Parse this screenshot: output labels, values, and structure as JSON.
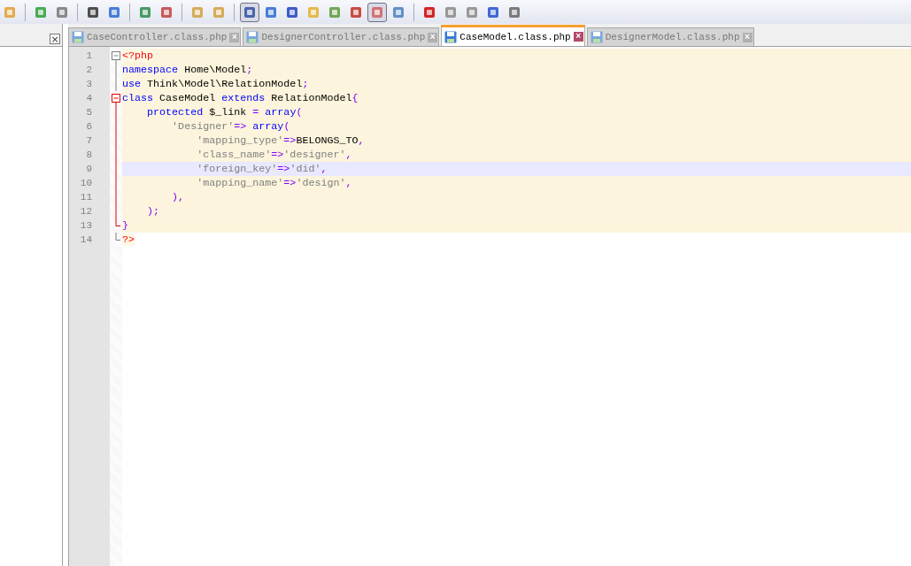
{
  "toolbar": [
    [
      {
        "pressed": false
      }
    ],
    [
      {
        "pressed": false
      },
      {
        "pressed": false
      }
    ],
    [
      {
        "pressed": false
      },
      {
        "pressed": false
      }
    ],
    [
      {
        "pressed": false
      },
      {
        "pressed": false
      }
    ],
    [
      {
        "pressed": false
      },
      {
        "pressed": false
      }
    ],
    [
      {
        "pressed": true
      },
      {
        "pressed": false
      },
      {
        "pressed": false
      },
      {
        "pressed": false
      },
      {
        "pressed": false
      },
      {
        "pressed": false
      },
      {
        "pressed": true
      },
      {
        "pressed": false
      }
    ],
    [
      {
        "pressed": false
      },
      {
        "pressed": false
      },
      {
        "pressed": false
      },
      {
        "pressed": false
      },
      {
        "pressed": false
      }
    ]
  ],
  "side_panel": {
    "close": "×"
  },
  "tabs": [
    {
      "label": "CaseController.class.php",
      "selected": false,
      "close": "×"
    },
    {
      "label": "DesignerController.class.php",
      "selected": false,
      "close": "×"
    },
    {
      "label": "CaseModel.class.php",
      "selected": true,
      "close": "×"
    },
    {
      "label": "DesignerModel.class.php",
      "selected": false,
      "close": "×"
    }
  ],
  "editor": {
    "lines": [
      {
        "number": "1",
        "current": false,
        "embedded": true,
        "kind": "start",
        "active": false,
        "tokens": [
          {
            "kind": "php",
            "text": "<?php"
          }
        ]
      },
      {
        "number": "2",
        "current": false,
        "embedded": true,
        "kind": "body",
        "active": false,
        "tokens": [
          {
            "kind": "kw",
            "text": "namespace"
          },
          {
            "kind": "plain",
            "text": " Home\\Model"
          },
          {
            "kind": "op",
            "text": ";"
          }
        ]
      },
      {
        "number": "3",
        "current": false,
        "embedded": true,
        "kind": "body",
        "active": false,
        "tokens": [
          {
            "kind": "kw",
            "text": "use"
          },
          {
            "kind": "plain",
            "text": " Think\\Model\\RelationModel"
          },
          {
            "kind": "op",
            "text": ";"
          }
        ]
      },
      {
        "number": "4",
        "current": false,
        "embedded": true,
        "kind": "start",
        "active": true,
        "tokens": [
          {
            "kind": "kw",
            "text": "class"
          },
          {
            "kind": "plain",
            "text": " CaseModel "
          },
          {
            "kind": "kw",
            "text": "extends"
          },
          {
            "kind": "plain",
            "text": " RelationModel"
          },
          {
            "kind": "op",
            "text": "{"
          }
        ]
      },
      {
        "number": "5",
        "current": false,
        "embedded": true,
        "kind": "body",
        "active": true,
        "tokens": [
          {
            "kind": "kw",
            "text": "    protected"
          },
          {
            "kind": "plain",
            "text": " $_link "
          },
          {
            "kind": "op",
            "text": "="
          },
          {
            "kind": "kw",
            "text": " array"
          },
          {
            "kind": "op",
            "text": "("
          }
        ]
      },
      {
        "number": "6",
        "current": false,
        "embedded": true,
        "kind": "body",
        "active": true,
        "tokens": [
          {
            "kind": "str",
            "text": "        'Designer'"
          },
          {
            "kind": "op",
            "text": "=>"
          },
          {
            "kind": "kw",
            "text": " array"
          },
          {
            "kind": "op",
            "text": "("
          }
        ]
      },
      {
        "number": "7",
        "current": false,
        "embedded": true,
        "kind": "body",
        "active": true,
        "tokens": [
          {
            "kind": "str",
            "text": "            'mapping_type'"
          },
          {
            "kind": "op",
            "text": "=>"
          },
          {
            "kind": "plain",
            "text": "BELONGS_TO"
          },
          {
            "kind": "op",
            "text": ","
          }
        ]
      },
      {
        "number": "8",
        "current": false,
        "embedded": true,
        "kind": "body",
        "active": true,
        "tokens": [
          {
            "kind": "str",
            "text": "            'class_name'"
          },
          {
            "kind": "op",
            "text": "=>"
          },
          {
            "kind": "str",
            "text": "'designer'"
          },
          {
            "kind": "op",
            "text": ","
          }
        ]
      },
      {
        "number": "9",
        "current": true,
        "embedded": true,
        "kind": "body",
        "active": true,
        "tokens": [
          {
            "kind": "str",
            "text": "            'foreign_key'"
          },
          {
            "kind": "op",
            "text": "=>"
          },
          {
            "kind": "str",
            "text": "'did'"
          },
          {
            "kind": "op",
            "text": ","
          }
        ]
      },
      {
        "number": "10",
        "current": false,
        "embedded": true,
        "kind": "body",
        "active": true,
        "tokens": [
          {
            "kind": "str",
            "text": "            'mapping_name'"
          },
          {
            "kind": "op",
            "text": "=>"
          },
          {
            "kind": "str",
            "text": "'design'"
          },
          {
            "kind": "op",
            "text": ","
          }
        ]
      },
      {
        "number": "11",
        "current": false,
        "embedded": true,
        "kind": "body",
        "active": true,
        "tokens": [
          {
            "kind": "op",
            "text": "        ),"
          }
        ]
      },
      {
        "number": "12",
        "current": false,
        "embedded": true,
        "kind": "body",
        "active": true,
        "tokens": [
          {
            "kind": "op",
            "text": "    );"
          }
        ]
      },
      {
        "number": "13",
        "current": false,
        "embedded": true,
        "kind": "end",
        "active": true,
        "tokens": [
          {
            "kind": "op",
            "text": "}"
          }
        ]
      },
      {
        "number": "14",
        "current": false,
        "embedded": false,
        "kind": "end",
        "active": false,
        "tokens": [
          {
            "kind": "php",
            "text": "?>"
          }
        ]
      }
    ]
  }
}
